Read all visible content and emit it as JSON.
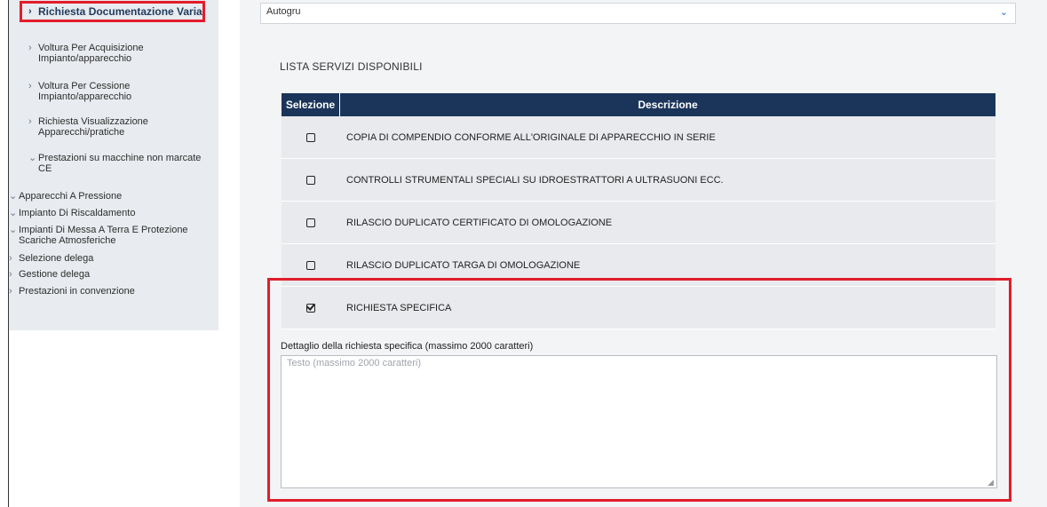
{
  "sidebar": {
    "items": [
      {
        "label": "Richiesta Documentazione Varia",
        "chevron": "›",
        "active": true
      },
      {
        "label": "Voltura Per Acquisizione\nImpianto/apparecchio",
        "chevron": "›"
      },
      {
        "label": "Voltura Per Cessione\nImpianto/apparecchio",
        "chevron": "›"
      },
      {
        "label": "Richiesta Visualizzazione\nApparecchi/pratiche",
        "chevron": "›"
      },
      {
        "label": "Prestazioni su macchine non marcate\nCE",
        "chevron": "⌄"
      },
      {
        "label": "Apparecchi A Pressione",
        "chevron": "⌄"
      },
      {
        "label": "Impianto Di Riscaldamento",
        "chevron": "⌄"
      },
      {
        "label": "Impianti Di Messa A Terra E Protezione\nScariche Atmosferiche",
        "chevron": "⌄"
      },
      {
        "label": "Selezione delega",
        "chevron": "›"
      },
      {
        "label": "Gestione delega",
        "chevron": "›"
      },
      {
        "label": "Prestazioni in convenzione",
        "chevron": "›"
      }
    ]
  },
  "main": {
    "select_value": "Autogru",
    "select_arrow": "⌄",
    "section_title": "LISTA SERVIZI DISPONIBILI",
    "table": {
      "headers": {
        "selection": "Selezione",
        "description": "Descrizione"
      },
      "rows": [
        {
          "label": "COPIA DI COMPENDIO CONFORME ALL'ORIGINALE DI APPARECCHIO IN SERIE",
          "checked": false
        },
        {
          "label": "CONTROLLI STRUMENTALI SPECIALI SU IDROESTRATTORI A ULTRASUONI ECC.",
          "checked": false
        },
        {
          "label": "RILASCIO DUPLICATO CERTIFICATO DI OMOLOGAZIONE",
          "checked": false
        },
        {
          "label": "RILASCIO DUPLICATO TARGA DI OMOLOGAZIONE",
          "checked": false
        },
        {
          "label": "RICHIESTA SPECIFICA",
          "checked": true
        }
      ]
    },
    "detail_label": "Dettaglio della richiesta specifica (massimo 2000 caratteri)",
    "detail_placeholder": "Testo (massimo 2000 caratteri)"
  },
  "colors": {
    "highlight": "#e21d2b",
    "table_header": "#1b355a",
    "sidebar_bg": "#e8ebef"
  }
}
